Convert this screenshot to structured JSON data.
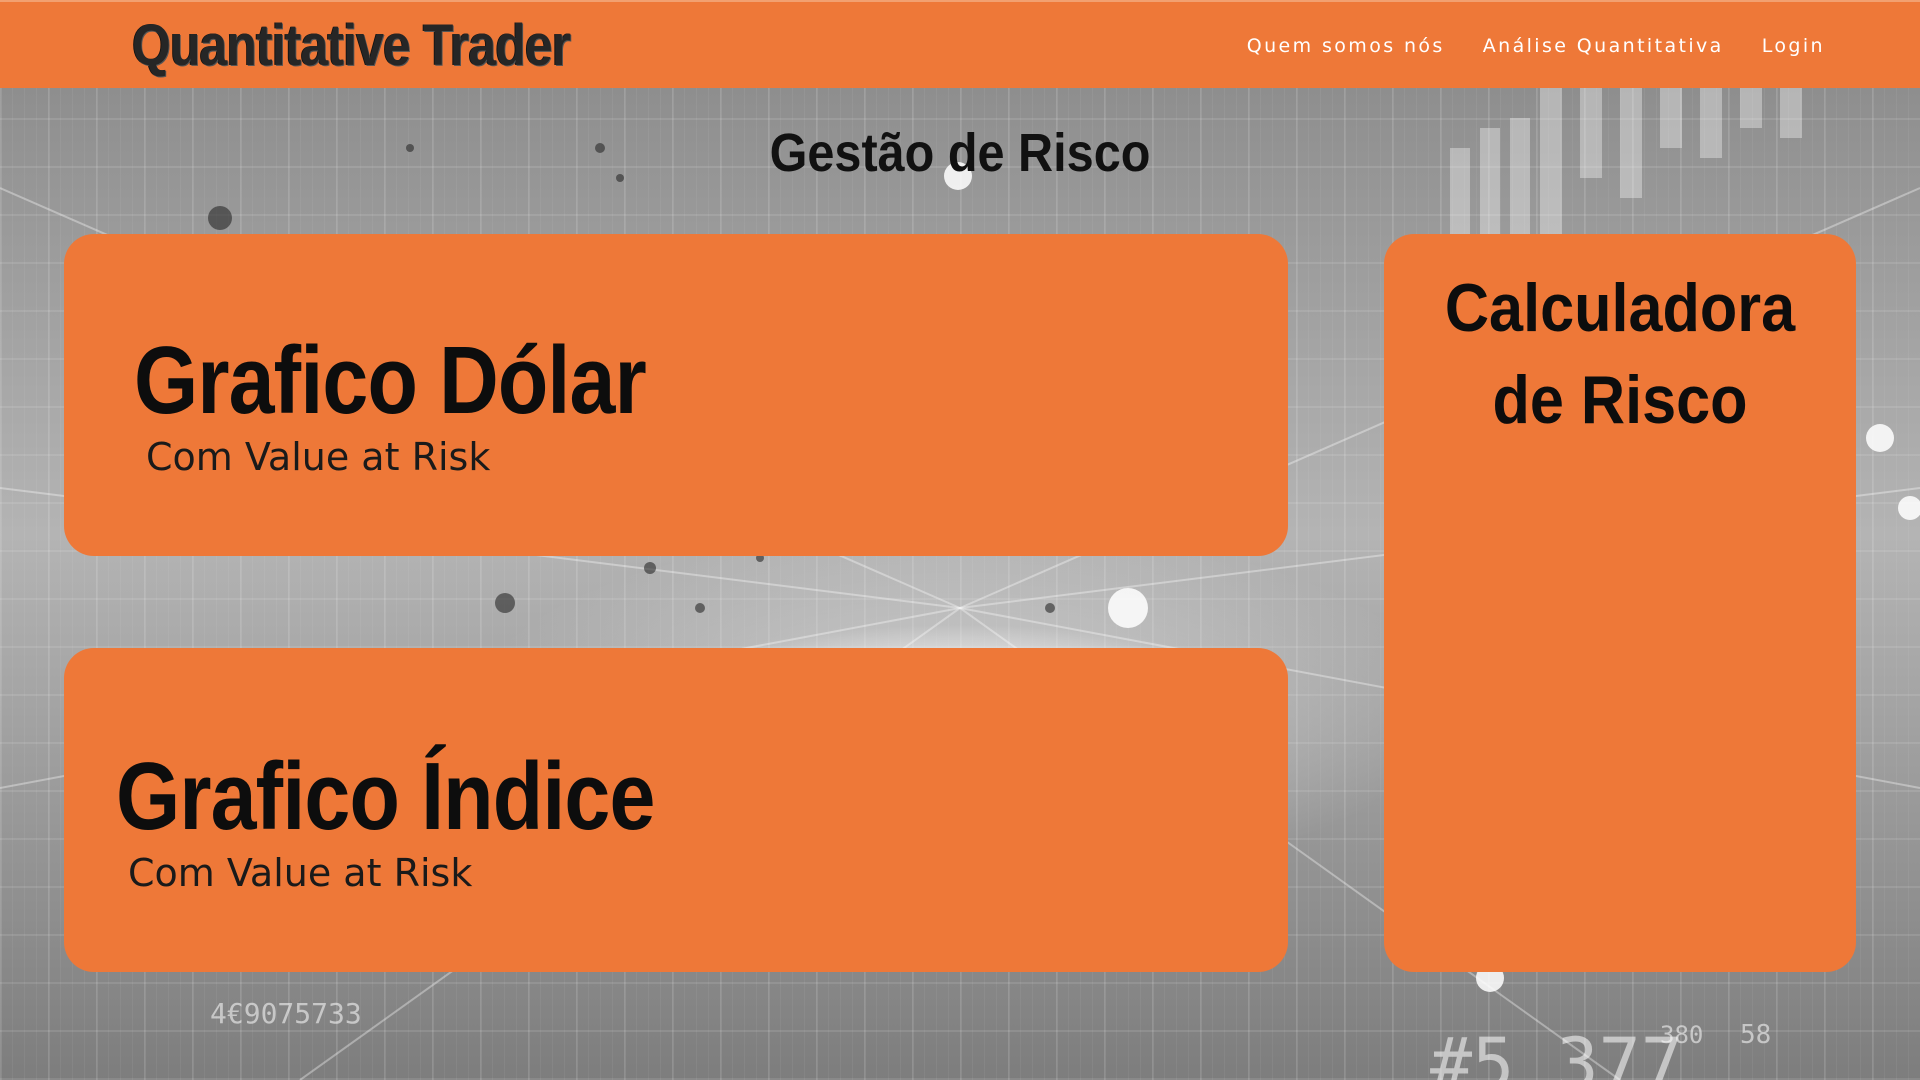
{
  "header": {
    "logo_text": "Quantitative Trader",
    "nav": [
      {
        "label": "Quem somos nós"
      },
      {
        "label": "Análise Quantitativa"
      },
      {
        "label": "Login"
      }
    ]
  },
  "page": {
    "title": "Gestão de Risco"
  },
  "cards": {
    "dolar": {
      "title": "Grafico Dólar",
      "subtitle": "Com Value at Risk"
    },
    "indice": {
      "title": "Grafico Índice",
      "subtitle": "Com Value at Risk"
    },
    "calculadora": {
      "title_line1": "Calculadora",
      "title_line2": "de Risco"
    }
  },
  "colors": {
    "accent_orange": "#ee7838",
    "text_dark": "#111111",
    "nav_text": "#ffffff"
  }
}
